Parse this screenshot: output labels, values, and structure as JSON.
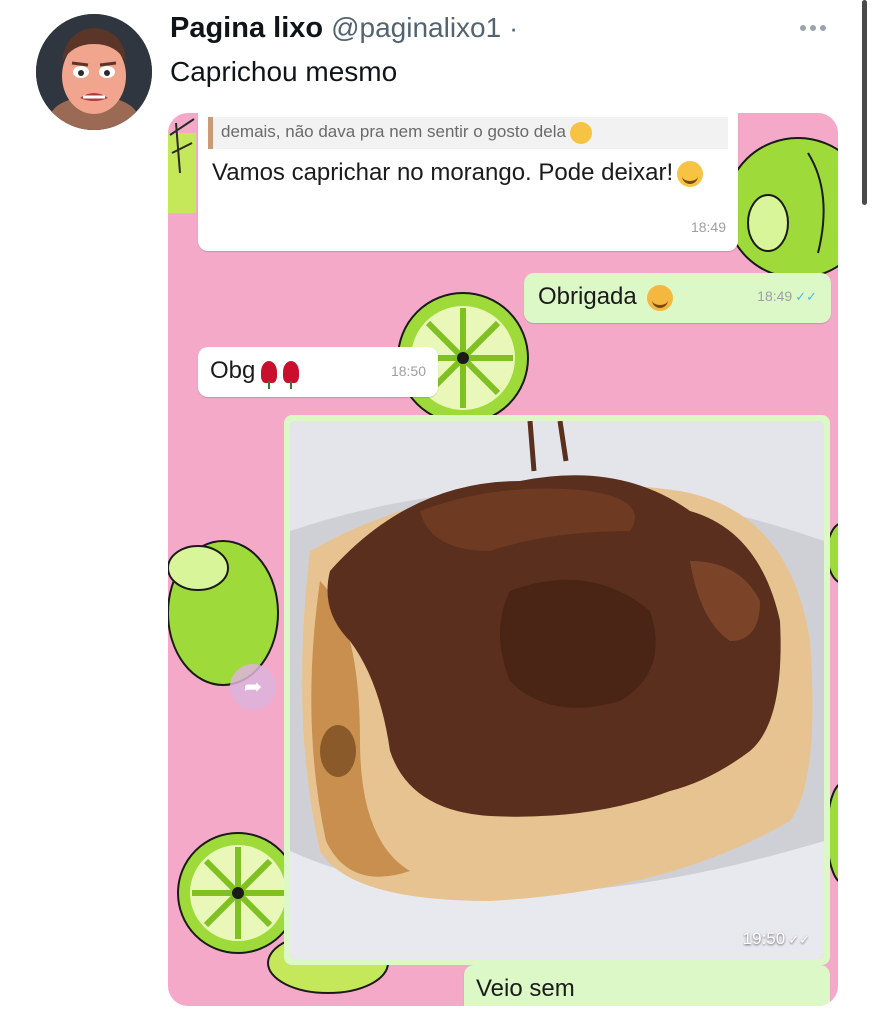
{
  "tweet": {
    "display_name": "Pagina lixo",
    "handle": "@paginalixo1",
    "separator": "·",
    "text": "Caprichou mesmo",
    "more_icon": "more-horizontal-icon"
  },
  "chat": {
    "quoted_text": "demais, não dava pra nem sentir o gosto dela",
    "message_1": "Vamos caprichar no morango. Pode deixar!",
    "message_1_time": "18:49",
    "message_2": "Obrigada",
    "message_2_time": "18:49",
    "message_3": "Obg",
    "message_3_time": "18:50",
    "photo_time": "19:50",
    "message_4": "Veio sem",
    "ticks": "✓✓",
    "forward_icon": "forward-arrow-icon",
    "colors": {
      "chat_background": "#f4a9c8",
      "incoming_bubble": "#ffffff",
      "outgoing_bubble": "#dcf8c6",
      "read_ticks": "#4fb6ec"
    }
  }
}
